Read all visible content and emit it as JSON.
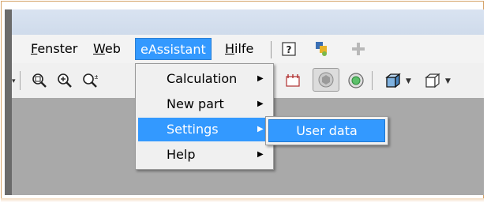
{
  "menubar": {
    "items": [
      {
        "label": "Fenster",
        "accel": "F"
      },
      {
        "label": "Web",
        "accel": "W"
      },
      {
        "label": "eAssistant",
        "accel": ""
      },
      {
        "label": "Hilfe",
        "accel": "H"
      }
    ],
    "icons": [
      "help-context-icon",
      "plugin-icon",
      "add-icon"
    ]
  },
  "toolbar": {
    "icons": [
      "zoom-window-icon",
      "zoom-icon",
      "zoom-dynamic-icon",
      "section-view-icon",
      "shaded-view-icon",
      "render-view-icon",
      "cube-solid-icon",
      "cube-wireframe-icon"
    ]
  },
  "dropdown": {
    "items": [
      {
        "label": "Calculation",
        "has_submenu": true
      },
      {
        "label": "New part",
        "has_submenu": true
      },
      {
        "label": "Settings",
        "has_submenu": true
      },
      {
        "label": "Help",
        "has_submenu": true
      }
    ],
    "highlighted": "Settings"
  },
  "submenu": {
    "items": [
      {
        "label": "User data"
      }
    ]
  },
  "colors": {
    "highlight": "#3399ff",
    "frame": "#d6a46a",
    "workspace": "#a9a9a9"
  }
}
